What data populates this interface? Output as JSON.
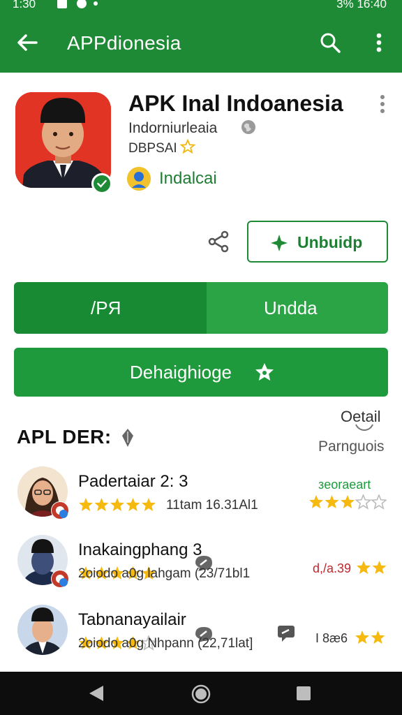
{
  "status_bar": {
    "time": "1:30",
    "right": "3%  16:40"
  },
  "app_bar": {
    "title": "APPdionesia"
  },
  "app": {
    "title": "APK Inal Indoanesia",
    "developer": "Indorniurleaia",
    "package": "DBPSAI",
    "author": "Indalcai"
  },
  "actions": {
    "update_outline": "Unbuidp",
    "split_left": "/PЯ",
    "split_right": "Undda",
    "rate": "Dehaighioge"
  },
  "reviews_section": {
    "title": "APL DER:",
    "detail": "Oetail",
    "sort": "Parnguois"
  },
  "reviews": [
    {
      "name": "Padertaiar 2: 3",
      "meta": "11tam 16.31Al1",
      "stars": 5,
      "side_text": "зeoraeart",
      "side_stars": 3,
      "side_color": "#1e9a3c"
    },
    {
      "name": "Inakaingphang 3",
      "meta": "2oiodo a0g lahgam (23/71bl1",
      "stars": 5,
      "side_text": "d,/a.39",
      "side_stars": 2,
      "side_color": "#c0272d"
    },
    {
      "name": "Tabnanayailair",
      "meta": "2oiodo a0g Nhpann (22,71lat]",
      "stars": 4,
      "side_text": "I 8æ6",
      "side_stars": 2,
      "side_color": "#333333"
    }
  ],
  "colors": {
    "primary": "#1e8a36",
    "star": "#f5b90f"
  }
}
